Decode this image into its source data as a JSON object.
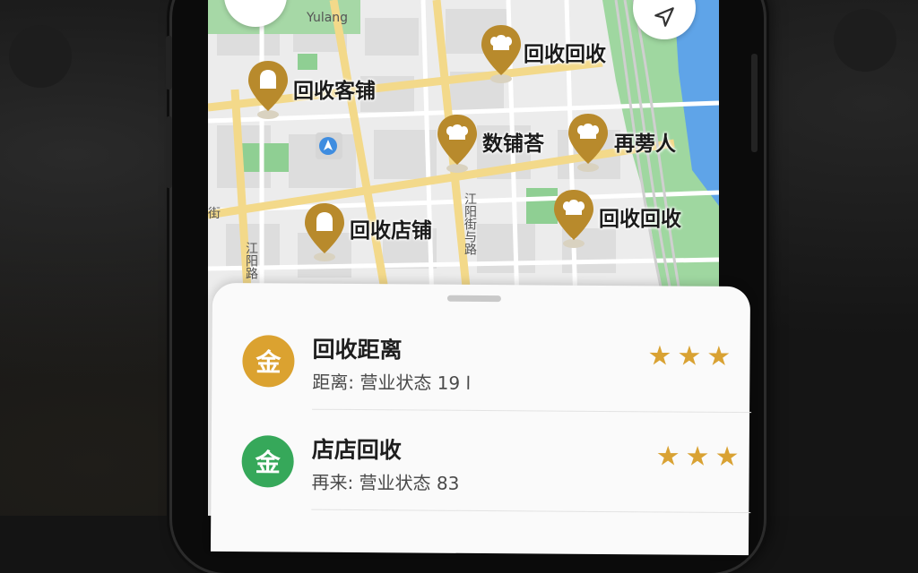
{
  "map": {
    "street_label_top": "Yulang",
    "street_label_center": "江阳街与路",
    "street_label_left": "江阳路",
    "street_label_edge": "街",
    "markers": [
      {
        "label": "回收回收",
        "icon": "hat-icon"
      },
      {
        "label": "回收客铺",
        "icon": "bell-icon"
      },
      {
        "label": "数铺荅",
        "icon": "hat-icon"
      },
      {
        "label": "再蒡人",
        "icon": "hat-icon"
      },
      {
        "label": "回收店铺",
        "icon": "bell-icon"
      },
      {
        "label": "回收回收",
        "icon": "hat-icon"
      }
    ],
    "colors": {
      "pin": "#b88a2c",
      "park": "#8fcf93",
      "water": "#5fa4e8",
      "road": "#f3d98a"
    }
  },
  "sheet": {
    "items": [
      {
        "badge": "金",
        "badge_color": "#dba230",
        "title": "回收距离",
        "subtitle": "距离: 营业状态  19 l",
        "rating": [
          "★",
          "★",
          "★"
        ]
      },
      {
        "badge": "金",
        "badge_color": "#36a85a",
        "title": "店店回收",
        "subtitle": "再来: 营业状态  83",
        "rating": [
          "★",
          "★",
          "★"
        ]
      }
    ]
  }
}
